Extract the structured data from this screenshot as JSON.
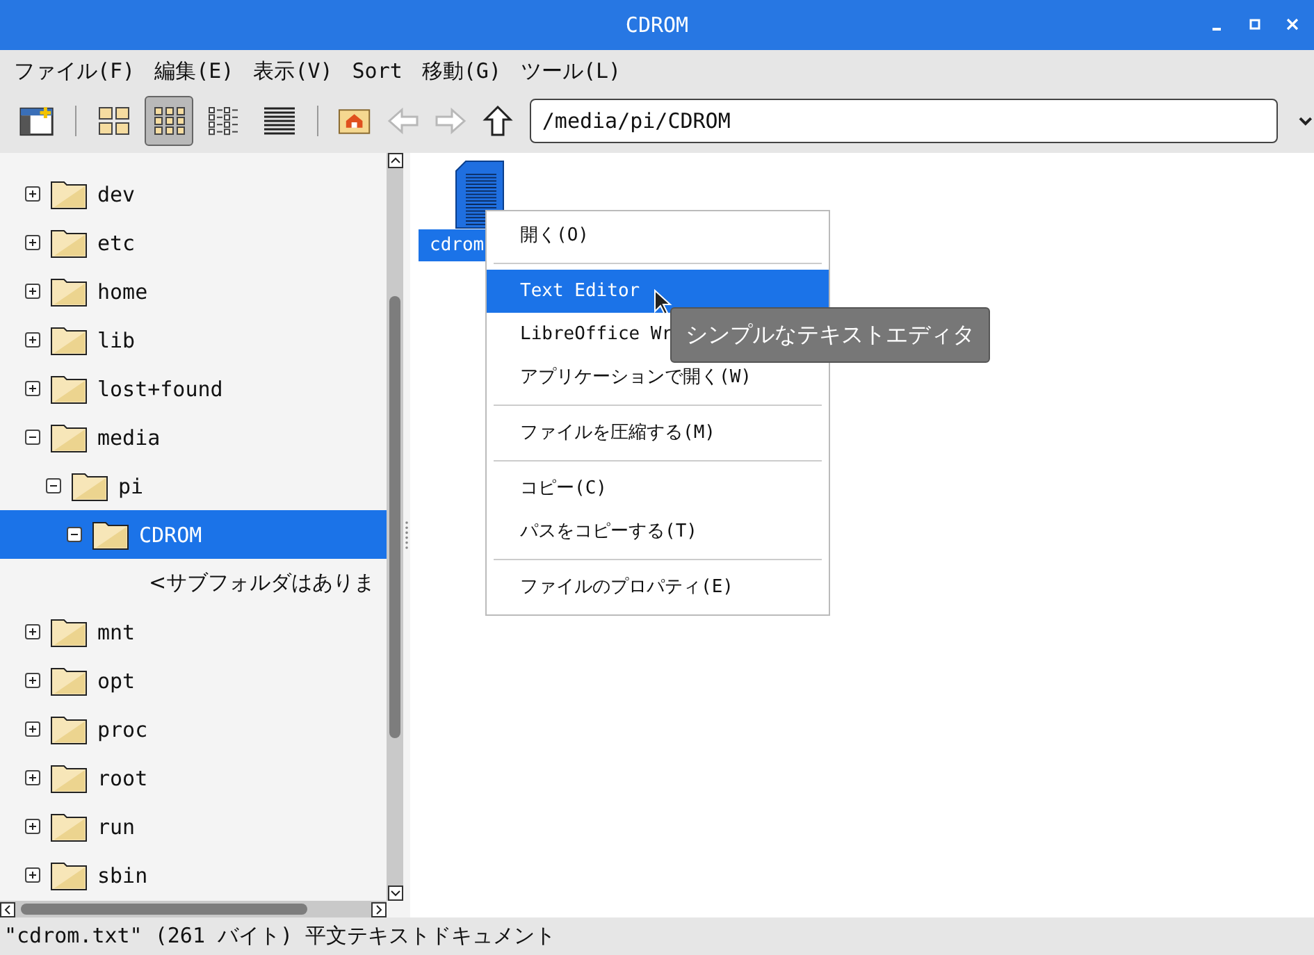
{
  "window": {
    "title": "CDROM"
  },
  "menu": [
    "ファイル(F)",
    "編集(E)",
    "表示(V)",
    "Sort",
    "移動(G)",
    "ツール(L)"
  ],
  "toolbar": {
    "view_modes": [
      {
        "selected": false
      },
      {
        "selected": true
      },
      {
        "selected": false
      },
      {
        "selected": false
      }
    ],
    "nav": [
      {
        "kind": "back",
        "disabled": true
      },
      {
        "kind": "forward",
        "disabled": true
      },
      {
        "kind": "up",
        "disabled": false
      }
    ],
    "path": "/media/pi/CDROM"
  },
  "tree": [
    {
      "label": "dev",
      "expanded": false,
      "selected": false
    },
    {
      "label": "etc",
      "expanded": false,
      "selected": false
    },
    {
      "label": "home",
      "expanded": false,
      "selected": false
    },
    {
      "label": "lib",
      "expanded": false,
      "selected": false
    },
    {
      "label": "lost+found",
      "expanded": false,
      "selected": false
    },
    {
      "label": "media",
      "expanded": true,
      "selected": false,
      "children": [
        {
          "label": "pi",
          "expanded": true,
          "selected": false,
          "children": [
            {
              "label": "CDROM",
              "expanded": true,
              "selected": true,
              "note": "<サブフォルダはありま"
            }
          ]
        }
      ]
    },
    {
      "label": "mnt",
      "expanded": false,
      "selected": false
    },
    {
      "label": "opt",
      "expanded": false,
      "selected": false
    },
    {
      "label": "proc",
      "expanded": false,
      "selected": false
    },
    {
      "label": "root",
      "expanded": false,
      "selected": false
    },
    {
      "label": "run",
      "expanded": false,
      "selected": false
    },
    {
      "label": "sbin",
      "expanded": false,
      "selected": false
    }
  ],
  "files": [
    {
      "name": "cdrom",
      "selected": true
    }
  ],
  "context_menu": {
    "groups": [
      [
        {
          "label": "開く(O)",
          "selected": false
        }
      ],
      [
        {
          "label": "Text Editor",
          "selected": true
        },
        {
          "label": "LibreOffice Wr",
          "selected": false
        },
        {
          "label": "アプリケーションで開く(W)",
          "selected": false
        }
      ],
      [
        {
          "label": "ファイルを圧縮する(M)",
          "selected": false
        }
      ],
      [
        {
          "label": "コピー(C)",
          "selected": false
        },
        {
          "label": "パスをコピーする(T)",
          "selected": false
        }
      ],
      [
        {
          "label": "ファイルのプロパティ(E)",
          "selected": false
        }
      ]
    ]
  },
  "tooltip": "シンプルなテキストエディタ",
  "status_bar": "\"cdrom.txt\" (261 バイト) 平文テキストドキュメント"
}
